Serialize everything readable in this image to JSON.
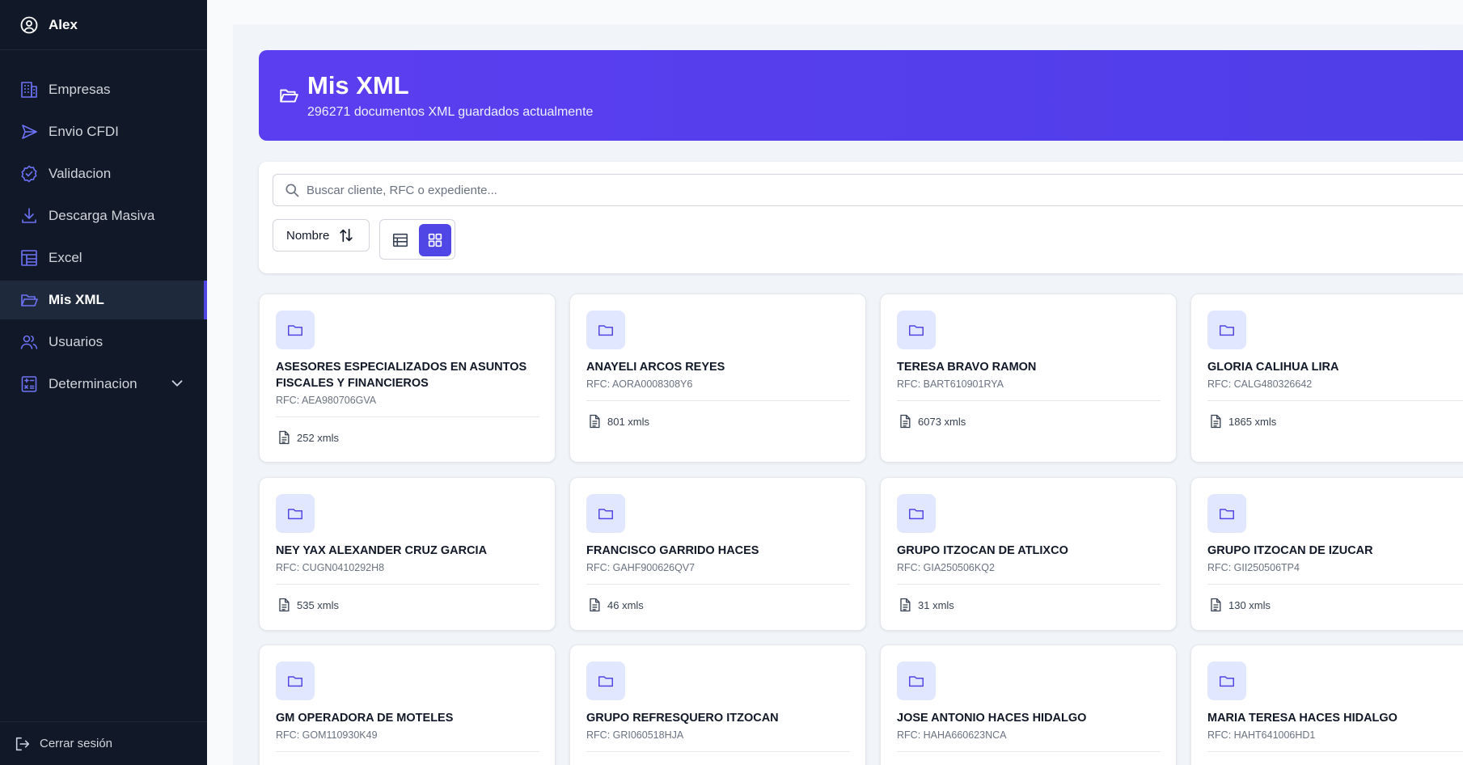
{
  "sidebar": {
    "user_name": "Alex",
    "items": [
      {
        "label": "Empresas",
        "icon": "building-icon"
      },
      {
        "label": "Envio CFDI",
        "icon": "send-icon"
      },
      {
        "label": "Validacion",
        "icon": "badge-check-icon"
      },
      {
        "label": "Descarga Masiva",
        "icon": "download-icon"
      },
      {
        "label": "Excel",
        "icon": "table-icon"
      },
      {
        "label": "Mis XML",
        "icon": "folder-open-icon",
        "active": true
      },
      {
        "label": "Usuarios",
        "icon": "users-icon"
      },
      {
        "label": "Determinacion",
        "icon": "calculator-icon",
        "expandable": true
      }
    ],
    "logout_label": "Cerrar sesión"
  },
  "header": {
    "title": "Mis XML",
    "subtitle": "296271 documentos XML guardados actualmente"
  },
  "filters": {
    "search_placeholder": "Buscar cliente, RFC o expediente...",
    "sort_label": "Nombre",
    "view_mode": "grid"
  },
  "colors": {
    "accent": "#4f46e5",
    "sidebar_bg": "#111827",
    "icon_bg": "#e0e7ff"
  },
  "cards": [
    {
      "name": "ASESORES ESPECIALIZADOS EN ASUNTOS FISCALES Y FINANCIEROS",
      "rfc": "RFC: AEA980706GVA",
      "count": "252 xmls"
    },
    {
      "name": "ANAYELI ARCOS REYES",
      "rfc": "RFC: AORA0008308Y6",
      "count": "801 xmls"
    },
    {
      "name": "TERESA BRAVO RAMON",
      "rfc": "RFC: BART610901RYA",
      "count": "6073 xmls"
    },
    {
      "name": "GLORIA CALIHUA LIRA",
      "rfc": "RFC: CALG480326642",
      "count": "1865 xmls"
    },
    {
      "name": "NEY YAX ALEXANDER CRUZ GARCIA",
      "rfc": "RFC: CUGN0410292H8",
      "count": "535 xmls"
    },
    {
      "name": "FRANCISCO GARRIDO HACES",
      "rfc": "RFC: GAHF900626QV7",
      "count": "46 xmls"
    },
    {
      "name": "GRUPO ITZOCAN DE ATLIXCO",
      "rfc": "RFC: GIA250506KQ2",
      "count": "31 xmls"
    },
    {
      "name": "GRUPO ITZOCAN DE IZUCAR",
      "rfc": "RFC: GII250506TP4",
      "count": "130 xmls"
    },
    {
      "name": "GM OPERADORA DE MOTELES",
      "rfc": "RFC: GOM110930K49",
      "count": ""
    },
    {
      "name": "GRUPO REFRESQUERO ITZOCAN",
      "rfc": "RFC: GRI060518HJA",
      "count": ""
    },
    {
      "name": "JOSE ANTONIO HACES HIDALGO",
      "rfc": "RFC: HAHA660623NCA",
      "count": ""
    },
    {
      "name": "MARIA TERESA HACES HIDALGO",
      "rfc": "RFC: HAHT641006HD1",
      "count": ""
    }
  ]
}
